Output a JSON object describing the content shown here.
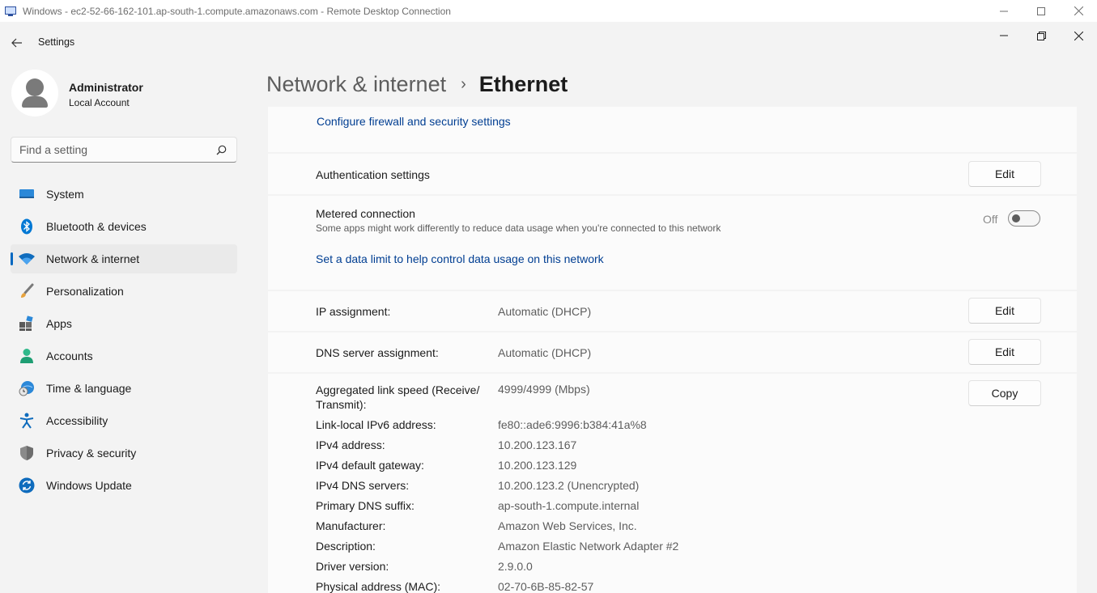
{
  "rdp": {
    "title": "Windows - ec2-52-66-162-101.ap-south-1.compute.amazonaws.com - Remote Desktop Connection"
  },
  "titlebar": {
    "app_title": "Settings"
  },
  "profile": {
    "name": "Administrator",
    "account_type": "Local Account"
  },
  "search": {
    "placeholder": "Find a setting"
  },
  "sidebar": {
    "items": [
      {
        "label": "System",
        "icon": "monitor-icon"
      },
      {
        "label": "Bluetooth & devices",
        "icon": "bluetooth-icon"
      },
      {
        "label": "Network & internet",
        "icon": "wifi-icon",
        "active": true
      },
      {
        "label": "Personalization",
        "icon": "paintbrush-icon"
      },
      {
        "label": "Apps",
        "icon": "apps-icon"
      },
      {
        "label": "Accounts",
        "icon": "person-icon"
      },
      {
        "label": "Time & language",
        "icon": "globe-clock-icon"
      },
      {
        "label": "Accessibility",
        "icon": "accessibility-icon"
      },
      {
        "label": "Privacy & security",
        "icon": "shield-icon"
      },
      {
        "label": "Windows Update",
        "icon": "update-icon"
      }
    ]
  },
  "header": {
    "parent": "Network & internet",
    "separator": "›",
    "current": "Ethernet"
  },
  "firewall": {
    "link": "Configure firewall and security settings"
  },
  "auth": {
    "label": "Authentication settings",
    "button": "Edit"
  },
  "metered": {
    "label": "Metered connection",
    "description": "Some apps might work differently to reduce data usage when you're connected to this network",
    "toggle_state": "Off",
    "data_limit_link": "Set a data limit to help control data usage on this network"
  },
  "ip": {
    "label": "IP assignment:",
    "value": "Automatic (DHCP)",
    "button": "Edit"
  },
  "dns": {
    "label": "DNS server assignment:",
    "value": "Automatic (DHCP)",
    "button": "Edit"
  },
  "properties": {
    "copy_button": "Copy",
    "link_speed_label_1": "Aggregated link speed (Receive/",
    "link_speed_label_2": "Transmit):",
    "link_speed_value": "4999/4999 (Mbps)",
    "items": [
      {
        "label": "Link-local IPv6 address:",
        "value": "fe80::ade6:9996:b384:41a%8"
      },
      {
        "label": "IPv4 address:",
        "value": "10.200.123.167"
      },
      {
        "label": "IPv4 default gateway:",
        "value": "10.200.123.129"
      },
      {
        "label": "IPv4 DNS servers:",
        "value": "10.200.123.2 (Unencrypted)"
      },
      {
        "label": "Primary DNS suffix:",
        "value": "ap-south-1.compute.internal"
      },
      {
        "label": "Manufacturer:",
        "value": "Amazon Web Services, Inc."
      },
      {
        "label": "Description:",
        "value": "Amazon Elastic Network Adapter #2"
      },
      {
        "label": "Driver version:",
        "value": "2.9.0.0"
      },
      {
        "label": "Physical address (MAC):",
        "value": "02-70-6B-85-82-57"
      }
    ]
  },
  "colors": {
    "accent": "#0067c0",
    "link": "#003e92",
    "background": "#f3f3f3",
    "card": "#fbfbfb"
  }
}
